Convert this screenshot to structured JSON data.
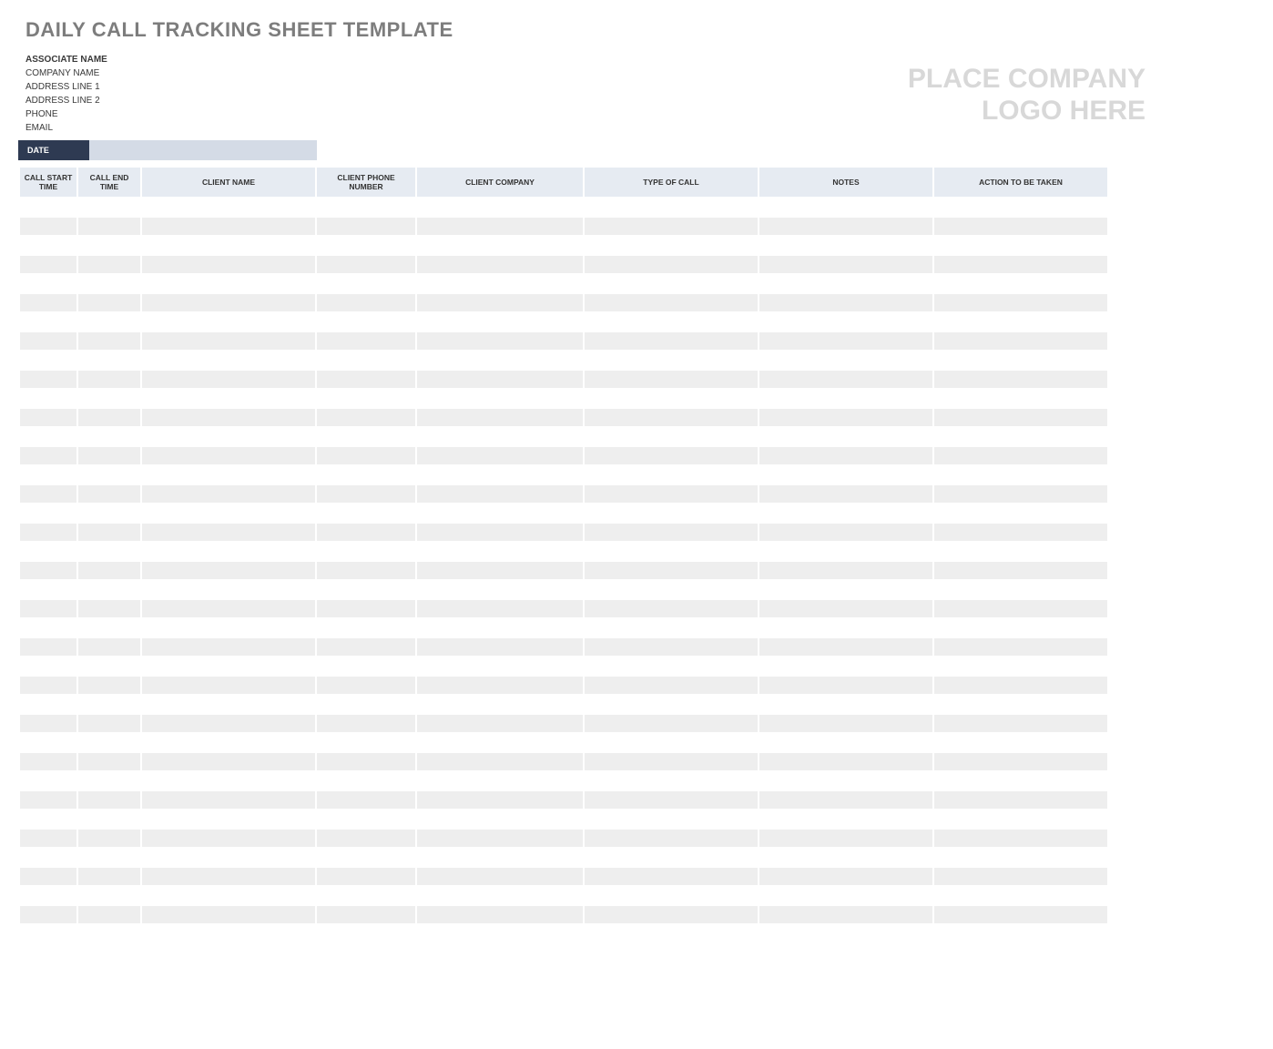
{
  "title": "DAILY CALL TRACKING SHEET TEMPLATE",
  "associate": {
    "name_label": "ASSOCIATE NAME",
    "company": "COMPANY NAME",
    "address1": "ADDRESS LINE 1",
    "address2": "ADDRESS LINE 2",
    "phone": "PHONE",
    "email": "EMAIL"
  },
  "logo_placeholder_line1": "PLACE COMPANY",
  "logo_placeholder_line2": "LOGO HERE",
  "date_label": "DATE",
  "date_value": "",
  "columns": {
    "call_start": "CALL START TIME",
    "call_end": "CALL END TIME",
    "client_name": "CLIENT NAME",
    "client_phone": "CLIENT PHONE NUMBER",
    "client_company": "CLIENT COMPANY",
    "type_of_call": "TYPE OF CALL",
    "notes": "NOTES",
    "action": "ACTION TO BE TAKEN"
  },
  "row_count": 38
}
